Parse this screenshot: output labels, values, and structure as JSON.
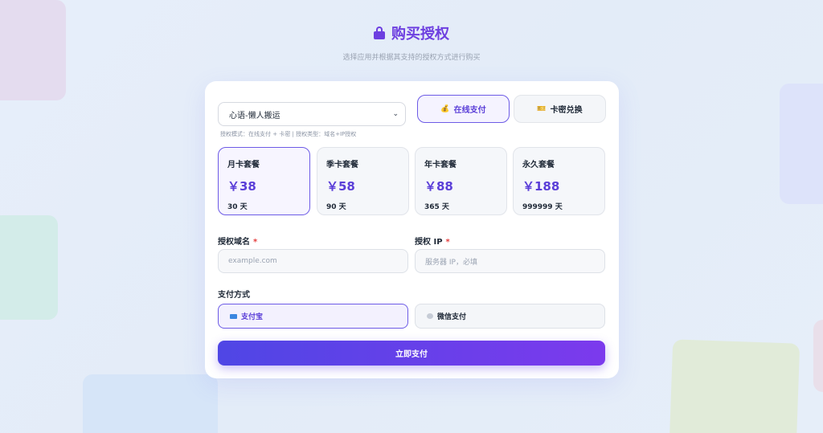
{
  "header": {
    "title": "购买授权",
    "subtitle": "选择应用并根据其支持的授权方式进行购买"
  },
  "app_select": {
    "value": "心语-懒人搬运",
    "hint": "授权模式：在线支付 + 卡密 | 授权类型：域名+IP授权"
  },
  "tabs": [
    {
      "label": "在线支付",
      "icon": "💰",
      "selected": true
    },
    {
      "label": "卡密兑换",
      "icon": "🎫",
      "selected": false
    }
  ],
  "plans": [
    {
      "name": "月卡套餐",
      "price": "￥38",
      "days": "30 天",
      "selected": true
    },
    {
      "name": "季卡套餐",
      "price": "￥58",
      "days": "90 天",
      "selected": false
    },
    {
      "name": "年卡套餐",
      "price": "￥88",
      "days": "365 天",
      "selected": false
    },
    {
      "name": "永久套餐",
      "price": "￥188",
      "days": "999999 天",
      "selected": false
    }
  ],
  "domain": {
    "label": "授权域名",
    "required_mark": "*",
    "placeholder": "example.com"
  },
  "ip": {
    "label": "授权 IP",
    "required_mark": "*",
    "placeholder": "服务器 IP，必填"
  },
  "payment": {
    "label": "支付方式",
    "options": [
      {
        "label": "支付宝",
        "selected": true
      },
      {
        "label": "微信支付",
        "selected": false
      }
    ]
  },
  "submit_label": "立即支付",
  "colors": {
    "accent": "#6d3fe0",
    "button_start": "#4f46e5",
    "button_end": "#7c3aed"
  }
}
